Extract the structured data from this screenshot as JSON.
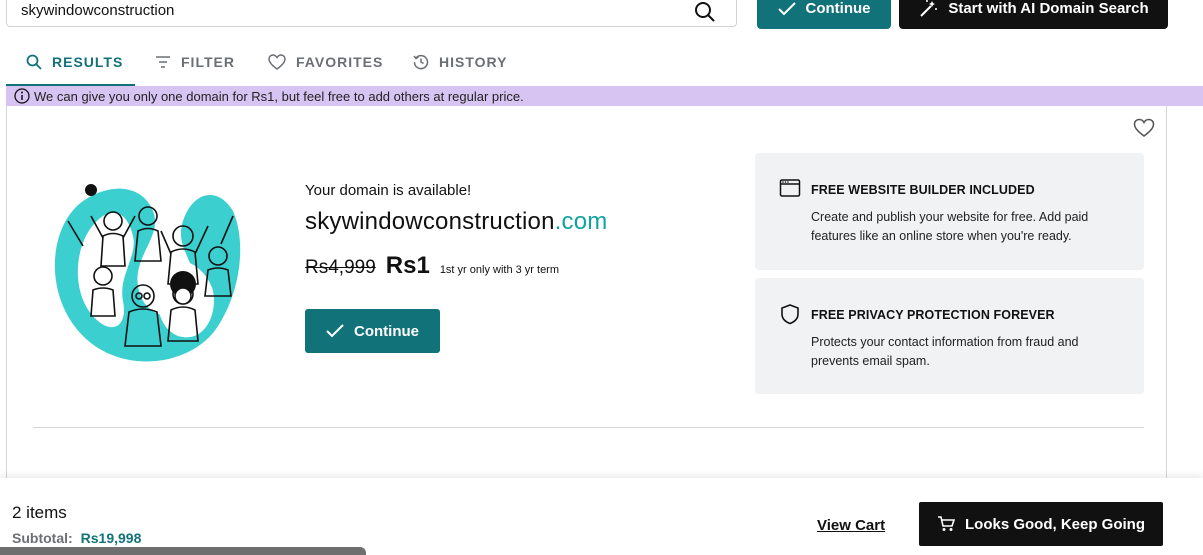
{
  "search": {
    "value": "skywindowconstruction"
  },
  "header": {
    "continue_label": "Continue",
    "ai_label": "Start with AI Domain Search"
  },
  "tabs": [
    {
      "label": "RESULTS",
      "icon": "search-icon",
      "active": true
    },
    {
      "label": "FILTER",
      "icon": "filter-icon"
    },
    {
      "label": "FAVORITES",
      "icon": "heart-icon"
    },
    {
      "label": "HISTORY",
      "icon": "history-icon"
    }
  ],
  "notice": {
    "text": "We can give you only one domain for Rs1, but feel free to add others at regular price."
  },
  "result": {
    "status": "Your domain is available!",
    "domain_name": "skywindowconstruction",
    "domain_tld": ".com",
    "old_price": "Rs4,999",
    "new_price": "Rs1",
    "term": "1st yr only with 3 yr term",
    "continue_label": "Continue"
  },
  "features": [
    {
      "icon": "browser-window-icon",
      "title": "FREE WEBSITE BUILDER INCLUDED",
      "desc": "Create and publish your website for free. Add paid features like an online store when you're ready."
    },
    {
      "icon": "shield-icon",
      "title": "FREE PRIVACY PROTECTION FOREVER",
      "desc": "Protects your contact information from fraud and prevents email spam."
    }
  ],
  "footer": {
    "items": "2 items",
    "subtotal_label": "Subtotal:",
    "subtotal_value": "Rs19,998",
    "view_cart": "View Cart",
    "keep_going": "Looks Good, Keep Going"
  },
  "colors": {
    "accent": "#11727a",
    "tld": "#11a2a2",
    "notice_bg": "#d8c4f2",
    "illustration": "#3ccfcf"
  }
}
